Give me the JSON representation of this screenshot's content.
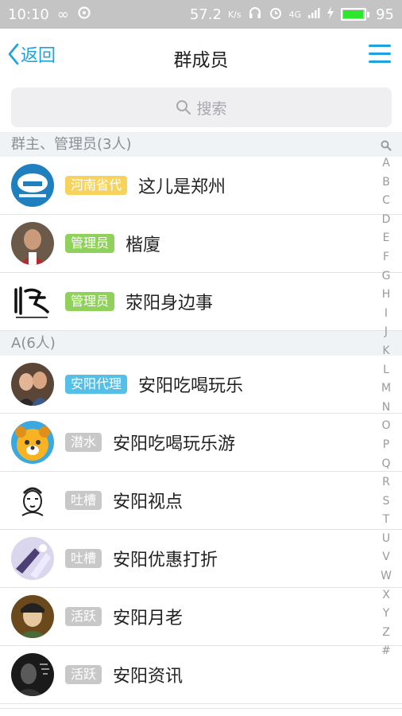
{
  "status_bar": {
    "time": "10:10",
    "speed": "57.2",
    "speed_unit": "K/s",
    "network": "4G",
    "battery": "95",
    "battery_level": 0.95
  },
  "header": {
    "back_label": "返回",
    "title": "群成员"
  },
  "search": {
    "placeholder": "搜索"
  },
  "sections": [
    {
      "title": "群主、管理员(3人)",
      "members": [
        {
          "tag": "河南省代",
          "tag_color": "#f6d35e",
          "name": "这儿是郑州",
          "avatar": "zhengzhou-logo-avatar"
        },
        {
          "tag": "管理员",
          "tag_color": "#8fd15a",
          "name": "楷廈",
          "avatar": "man-photo-avatar"
        },
        {
          "tag": "管理员",
          "tag_color": "#8fd15a",
          "name": "荥阳身边事",
          "avatar": "calligraphy-logo-avatar"
        }
      ]
    },
    {
      "title": "A(6人)",
      "members": [
        {
          "tag": "安阳代理",
          "tag_color": "#55bfe8",
          "name": "安阳吃喝玩乐",
          "avatar": "couple-photo-avatar"
        },
        {
          "tag": "潜水",
          "tag_color": "#c8c8c8",
          "name": "安阳吃喝玩乐游",
          "avatar": "cartoon-dog-avatar"
        },
        {
          "tag": "吐槽",
          "tag_color": "#c8c8c8",
          "name": "安阳视点",
          "avatar": "sketch-face-avatar"
        },
        {
          "tag": "吐槽",
          "tag_color": "#c8c8c8",
          "name": "安阳优惠打折",
          "avatar": "hands-photo-avatar"
        },
        {
          "tag": "活跃",
          "tag_color": "#c8c8c8",
          "name": "安阳月老",
          "avatar": "drama-photo-avatar"
        },
        {
          "tag": "活跃",
          "tag_color": "#c8c8c8",
          "name": "安阳资讯",
          "avatar": "dark-portrait-avatar"
        }
      ]
    }
  ],
  "index_bar": [
    "A",
    "B",
    "C",
    "D",
    "E",
    "F",
    "G",
    "H",
    "I",
    "J",
    "K",
    "L",
    "M",
    "N",
    "O",
    "P",
    "Q",
    "R",
    "S",
    "T",
    "U",
    "V",
    "W",
    "X",
    "Y",
    "Z",
    "#"
  ],
  "colors": {
    "accent": "#1aa3e0",
    "status_bar": "#c4c4c4",
    "section_bg": "#f0f3f6"
  }
}
